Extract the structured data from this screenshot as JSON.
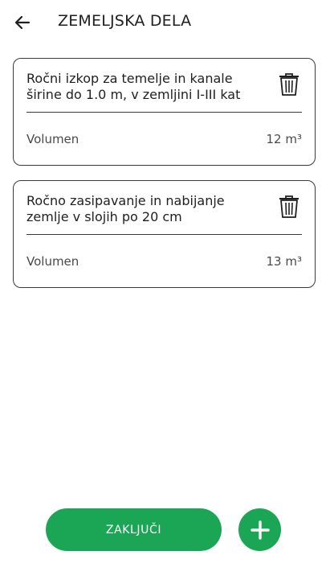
{
  "header": {
    "back_icon": "arrow-left-icon",
    "title": "ZEMELJSKA DELA"
  },
  "items": [
    {
      "title": "Ročni izkop za temelje in kanale širine do 1.0 m, v zemljini I-III kat",
      "volume_label": "Volumen",
      "volume_value": "12 m³",
      "delete_icon": "trash-icon"
    },
    {
      "title": "Ročno zasipavanje in nabijanje zemlje v slojih po 20 cm",
      "volume_label": "Volumen",
      "volume_value": "13 m³",
      "delete_icon": "trash-icon"
    }
  ],
  "footer": {
    "finish_label": "ZAKLJUČI",
    "add_icon": "plus-icon"
  },
  "colors": {
    "accent": "#1aa655",
    "text": "#1f1f1f",
    "border": "#3a3a3a"
  }
}
